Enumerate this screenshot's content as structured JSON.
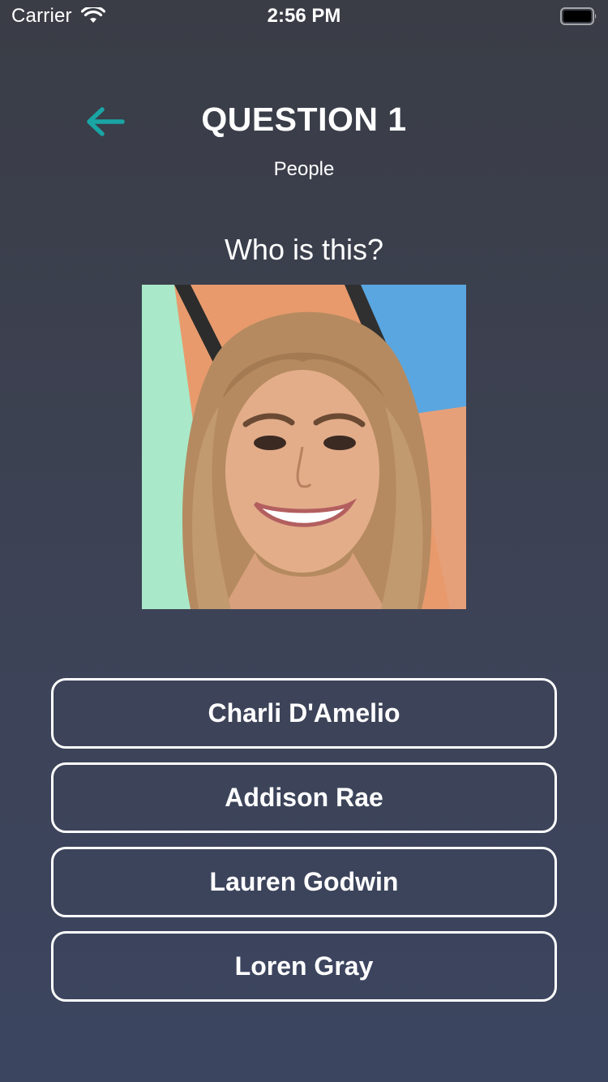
{
  "status_bar": {
    "carrier": "Carrier",
    "time": "2:56 PM",
    "icons": [
      "wifi-icon",
      "battery-icon"
    ]
  },
  "header": {
    "back_icon": "arrow-left-icon",
    "title": "QUESTION 1",
    "category": "People"
  },
  "question": {
    "prompt": "Who is this?",
    "image_subject": "portrait photo"
  },
  "answers": [
    {
      "label": "Charli D'Amelio"
    },
    {
      "label": "Addison Rae"
    },
    {
      "label": "Lauren Godwin"
    },
    {
      "label": "Loren Gray"
    }
  ],
  "colors": {
    "accent": "#1aa5a5",
    "background_top": "#3a3d46",
    "background_bottom": "#3c4560",
    "text": "#ffffff"
  }
}
